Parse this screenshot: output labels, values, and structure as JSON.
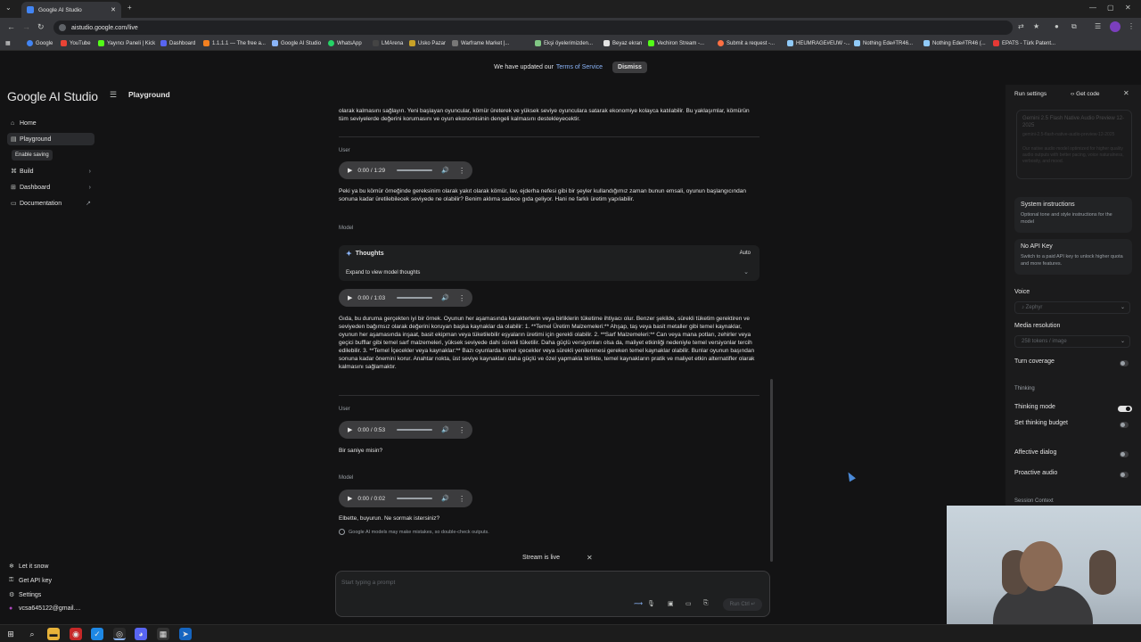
{
  "browser": {
    "tab_title": "Google AI Studio",
    "url": "aistudio.google.com/live",
    "bookmarks": [
      "Google",
      "YouTube",
      "Yayıncı Paneli | Kick",
      "Dashboard",
      "1.1.1.1 — The free a...",
      "Google AI Studio",
      "WhatsApp",
      "LMArena",
      "Usko Pazar",
      "Warframe Market |...",
      "Ekşi öyelerimizden...",
      "Beyaz ekran",
      "Vechiron Stream -...",
      "Submit a request -...",
      "HEUMRAGE#EUW -...",
      "Nothing Ede#TR46...",
      "Nothing Ede#TR46 (...",
      "EPATS - Türk Patent..."
    ]
  },
  "banner": {
    "text_before": "We have updated our",
    "link": "Terms of Service",
    "dismiss": "Dismiss"
  },
  "app": {
    "brand": "Google AI Studio",
    "page_title": "Playground"
  },
  "sidebar": {
    "items": [
      {
        "label": "Home",
        "icon": "home-icon"
      },
      {
        "label": "Playground",
        "icon": "playground-icon"
      },
      {
        "label": "Build",
        "icon": "build-icon"
      },
      {
        "label": "Dashboard",
        "icon": "dashboard-icon"
      },
      {
        "label": "Documentation",
        "icon": "book-icon"
      }
    ],
    "enable_saving": "Enable saving",
    "bottom": [
      {
        "label": "Let it snow"
      },
      {
        "label": "Get API key"
      },
      {
        "label": "Settings"
      },
      {
        "label": "vcsa645122@gmail...."
      }
    ]
  },
  "chat": {
    "top_text": "olarak kalmasını sağlayın. Yeni başlayan oyuncular, kömür üreterek ve yüksek seviye oyunculara satarak ekonomiye kolayca katılabilir. Bu yaklaşımlar, kömürün tüm seviyelerde değerini korumasını ve oyun ekonomisinin dengeli kalmasını destekleyecektir.",
    "messages": [
      {
        "role": "User",
        "time": "0:00 / 1:29",
        "text": "Peki ya bu kömür örneğinde gereksinim olarak yakıt olarak kömür, lav, ejderha nefesi gibi bir şeyler kullandığımız zaman bunun emsali, oyunun başlangıcından sonuna kadar üretilebilecek seviyede ne olabilir? Benim aklıma sadece gıda geliyor. Hani ne farklı üretim yapılabilir."
      },
      {
        "role": "Model",
        "time": "0:00 / 1:03",
        "thoughts_title": "Thoughts",
        "thoughts_mode": "Auto",
        "thoughts_expand": "Expand to view model thoughts",
        "text": "Gıda, bu duruma gerçekten iyi bir örnek. Oyunun her aşamasında karakterlerin veya birliklerin tüketime ihtiyacı olur. Benzer şekilde, sürekli tüketim gerektiren ve seviyeden bağımsız olarak değerini koruyan başka kaynaklar da olabilir: 1. **Temel Üretim Malzemeleri:** Ahşap, taş veya basit metaller gibi temel kaynaklar, oyunun her aşamasında inşaat, basit ekipman veya tüketilebilir eşyaların üretimi için gerekli olabilir. 2. **Sarf Malzemeleri:** Can veya mana potları, zehirler veya geçici bufflar gibi temel sarf malzemeleri, yüksek seviyede dahi sürekli tüketilir. Daha güçlü versiyonları olsa da, maliyet etkinliği nedeniyle temel versiyonlar tercih edilebilir. 3. **Temel İçecekler veya kaynaklar:** Bazı oyunlarda temel içecekler veya sürekli yenilenmesi gereken temel kaynaklar olabilir. Bunlar oyunun başından sonuna kadar önemini korur. Anahtar nokta, üst seviye kaynakları daha güçlü ve özel yapmakla birlikte, temel kaynakların pratik ve maliyet etkin alternatifler olarak kalmasını sağlamaktır."
      },
      {
        "role": "User",
        "time": "0:00 / 0:53",
        "text": "Bir saniye misin?"
      },
      {
        "role": "Model",
        "time": "0:00 / 0:02",
        "text": "Elbette, buyurun. Ne sormak istersiniz?"
      }
    ],
    "disclaimer": "Google AI models may make mistakes, so double-check outputs.",
    "stream_status": "Stream is live",
    "input_placeholder": "Start typing a prompt",
    "run_label": "Run Ctrl ↵"
  },
  "right_panel": {
    "title": "Run settings",
    "get_code": "Get code",
    "model_name": "Gemini 2.5 Flash Native Audio Preview 12-2025",
    "model_id": "gemini-2.5-flash-native-audio-preview-12-2025",
    "model_desc": "Our native audio model optimized for higher quality audio outputs with better pacing, voice naturalness, verbosity, and mood.",
    "system_instructions": {
      "title": "System instructions",
      "desc": "Optional tone and style instructions for the model"
    },
    "api_key": {
      "title": "No API Key",
      "desc": "Switch to a paid API key to unlock higher quota and more features."
    },
    "voice_label": "Voice",
    "voice_value": "Zephyr",
    "media_label": "Media resolution",
    "media_value": "258 tokens / image",
    "turn_coverage": "Turn coverage",
    "thinking_header": "Thinking",
    "thinking_mode": "Thinking mode",
    "thinking_budget": "Set thinking budget",
    "affective": "Affective dialog",
    "proactive": "Proactive audio",
    "session_context": "Session Context"
  },
  "colors": {
    "accent": "#8ab4f8",
    "bg": "#131314",
    "panel": "#1b1b1c"
  }
}
